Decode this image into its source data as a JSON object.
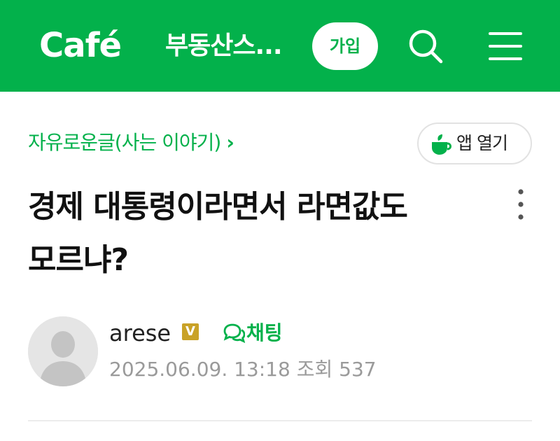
{
  "header": {
    "logo": "Café",
    "cafe_name": "부동산스...",
    "join_label": "가입",
    "icons": {
      "search": "search-icon",
      "menu": "menu-icon"
    },
    "brand_color": "#03b14b"
  },
  "article": {
    "board": "자유로운글(사는 이야기)",
    "board_chevron": "›",
    "app_open_label": "앱 열기",
    "title": "경제 대통령이라면서 라면값도 모르냐?",
    "author": "arese",
    "author_badge": "V",
    "chat_label": "채팅",
    "date": "2025.06.09. 13:18",
    "views_label": "조회",
    "views": "537"
  }
}
